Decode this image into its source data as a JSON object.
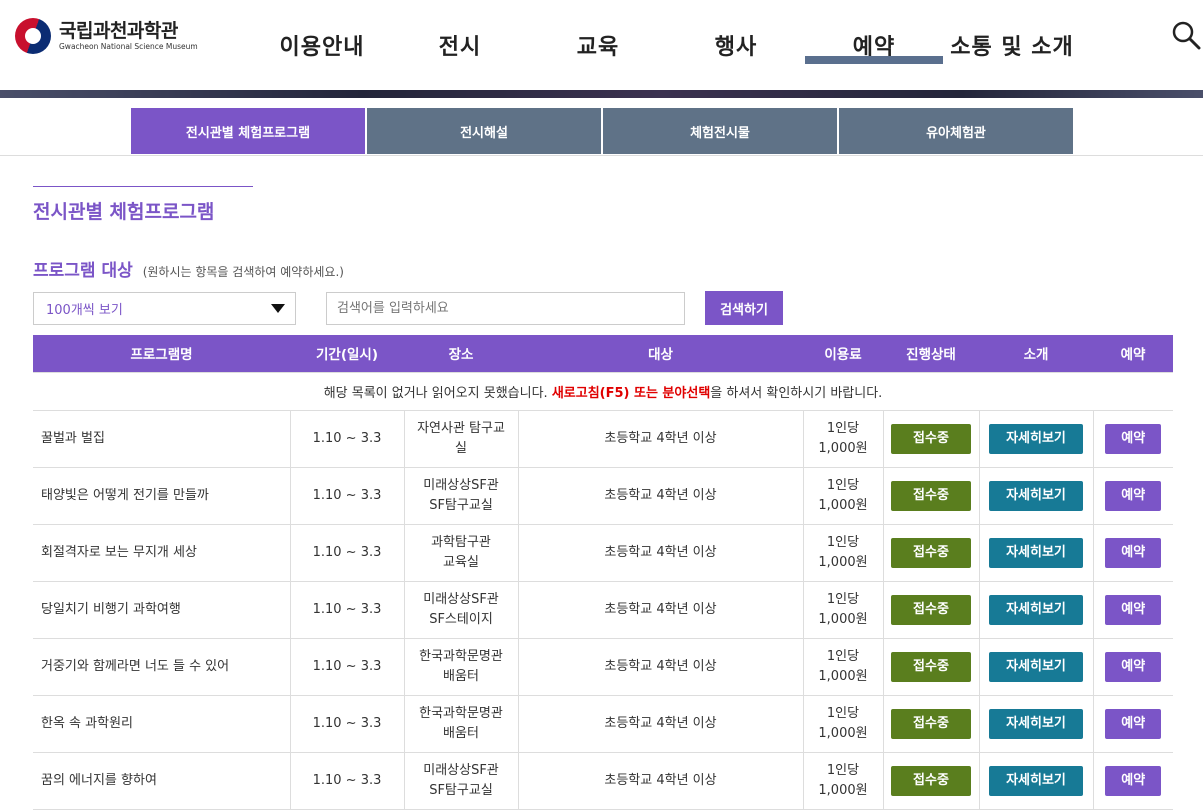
{
  "header": {
    "logo_ko": "국립과천과학관",
    "logo_en": "Gwacheon National Science Museum",
    "nav": [
      "이용안내",
      "전시",
      "교육",
      "행사",
      "예약",
      "소통 및 소개"
    ],
    "active_nav": "예약"
  },
  "tabs": [
    "전시관별 체험프로그램",
    "전시해설",
    "체험전시물",
    "유아체험관"
  ],
  "page_title": "전시관별 체험프로그램",
  "section": {
    "title": "프로그램 대상",
    "hint": "(원하시는 항목을 검색하여 예약하세요.)"
  },
  "filter": {
    "select_value": "100개씩 보기",
    "search_placeholder": "검색어를 입력하세요",
    "search_button": "검색하기"
  },
  "table": {
    "headers": [
      "프로그램명",
      "기간(일시)",
      "장소",
      "대상",
      "이용료",
      "진행상태",
      "소개",
      "예약"
    ],
    "notice_before": "해당 목록이 없거나 읽어오지 못했습니다. ",
    "notice_red": "새로고침(F5) 또는 분야선택",
    "notice_after": "을 하셔서 확인하시기 바랍니다.",
    "rows": [
      {
        "name": "꿀벌과 벌집",
        "period": "1.10 ~ 3.3",
        "place1": "자연사관 탐구교",
        "place2": "실",
        "target": "초등학교 4학년 이상",
        "fee1": "1인당",
        "fee2": "1,000원",
        "status": "접수중",
        "detail": "자세히보기",
        "reserve": "예약"
      },
      {
        "name": "태양빛은 어떻게 전기를 만들까",
        "period": "1.10 ~ 3.3",
        "place1": "미래상상SF관",
        "place2": "SF탐구교실",
        "target": "초등학교 4학년 이상",
        "fee1": "1인당",
        "fee2": "1,000원",
        "status": "접수중",
        "detail": "자세히보기",
        "reserve": "예약"
      },
      {
        "name": "회절격자로 보는 무지개 세상",
        "period": "1.10 ~ 3.3",
        "place1": "과학탐구관",
        "place2": "교육실",
        "target": "초등학교 4학년 이상",
        "fee1": "1인당",
        "fee2": "1,000원",
        "status": "접수중",
        "detail": "자세히보기",
        "reserve": "예약"
      },
      {
        "name": "당일치기 비행기 과학여행",
        "period": "1.10 ~ 3.3",
        "place1": "미래상상SF관",
        "place2": "SF스테이지",
        "target": "초등학교 4학년 이상",
        "fee1": "1인당",
        "fee2": "1,000원",
        "status": "접수중",
        "detail": "자세히보기",
        "reserve": "예약"
      },
      {
        "name": "거중기와 함께라면 너도 들 수 있어",
        "period": "1.10 ~ 3.3",
        "place1": "한국과학문명관",
        "place2": "배움터",
        "target": "초등학교 4학년 이상",
        "fee1": "1인당",
        "fee2": "1,000원",
        "status": "접수중",
        "detail": "자세히보기",
        "reserve": "예약"
      },
      {
        "name": "한옥 속 과학원리",
        "period": "1.10 ~ 3.3",
        "place1": "한국과학문명관",
        "place2": "배움터",
        "target": "초등학교 4학년 이상",
        "fee1": "1인당",
        "fee2": "1,000원",
        "status": "접수중",
        "detail": "자세히보기",
        "reserve": "예약"
      },
      {
        "name": "꿈의 에너지를 향하여",
        "period": "1.10 ~ 3.3",
        "place1": "미래상상SF관",
        "place2": "SF탐구교실",
        "target": "초등학교 4학년 이상",
        "fee1": "1인당",
        "fee2": "1,000원",
        "status": "접수중",
        "detail": "자세히보기",
        "reserve": "예약"
      }
    ]
  },
  "colors": {
    "accent": "#7b55c7",
    "tab_inactive": "#5f7287",
    "status_green": "#5a7e1e",
    "detail_teal": "#177a96"
  },
  "icons": {
    "search": "search-icon",
    "select_arrow": "chevron-down-icon"
  }
}
